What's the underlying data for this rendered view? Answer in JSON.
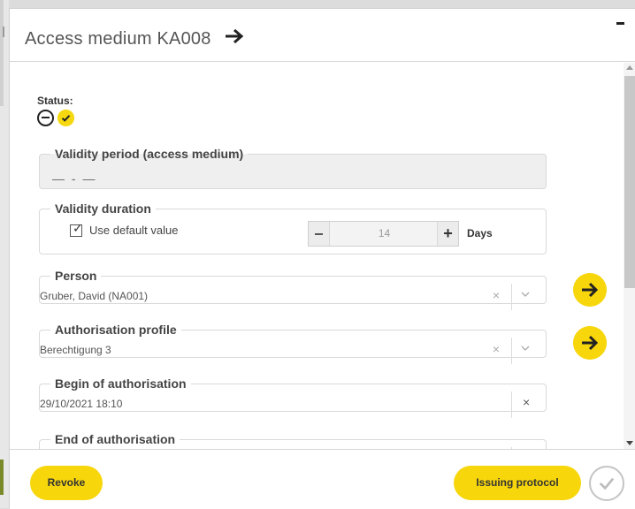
{
  "window": {
    "title": "Access medium KA008"
  },
  "status": {
    "label": "Status:"
  },
  "validity_period": {
    "legend": "Validity period (access medium)",
    "value": "— - —"
  },
  "validity_duration": {
    "legend": "Validity duration",
    "checkbox_label": "Use default value",
    "checkbox_mark": "✓",
    "minus_symbol": "−",
    "plus_symbol": "+",
    "value": "14",
    "unit": "Days"
  },
  "person": {
    "legend": "Person",
    "value": "Gruber, David (NA001)"
  },
  "authorisation_profile": {
    "legend": "Authorisation profile",
    "value": "Berechtigung 3"
  },
  "begin_of_authorisation": {
    "legend": "Begin of authorisation",
    "value": "29/10/2021 18:10"
  },
  "end_of_authorisation": {
    "legend": "End of authorisation",
    "value": ""
  },
  "clear_symbol": "×",
  "footer": {
    "revoke_label": "Revoke",
    "issuing_protocol_label": "Issuing protocol"
  },
  "colors": {
    "accent": "#f7d60c",
    "text": "#333333",
    "muted": "#999999"
  },
  "icons": [
    "arrow-right-icon",
    "minimize-icon",
    "minus-circle-icon",
    "check-circle-icon",
    "clear-icon",
    "chevron-down-icon",
    "confirm-check-icon"
  ]
}
